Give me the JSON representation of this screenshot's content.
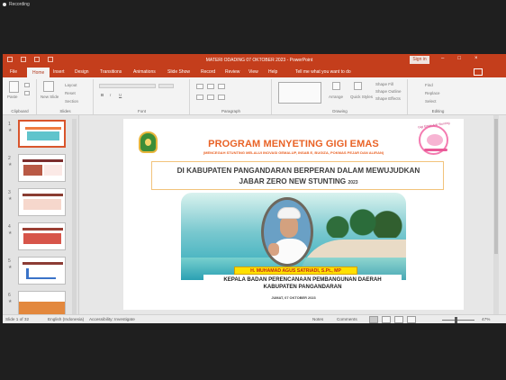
{
  "recording": {
    "label": "Recording"
  },
  "window": {
    "title": "MATERI ODADING 07 OKTOBER 2023  -  PowerPoint",
    "signin": "Sign in",
    "controls": {
      "minimize": "–",
      "maximize": "□",
      "close": "×"
    }
  },
  "tabs": [
    {
      "label": "File"
    },
    {
      "label": "Home"
    },
    {
      "label": "Insert"
    },
    {
      "label": "Design"
    },
    {
      "label": "Transitions"
    },
    {
      "label": "Animations"
    },
    {
      "label": "Slide Show"
    },
    {
      "label": "Record"
    },
    {
      "label": "Review"
    },
    {
      "label": "View"
    },
    {
      "label": "Help"
    }
  ],
  "tell_me": "Tell me what you want to do",
  "ribbon": {
    "clipboard": {
      "paste": "Paste",
      "group": "Clipboard"
    },
    "slides": {
      "new_slide": "New Slide",
      "layout": "Layout",
      "reset": "Reset",
      "section": "Section",
      "group": "Slides"
    },
    "font": {
      "group": "Font"
    },
    "paragraph": {
      "group": "Paragraph"
    },
    "drawing": {
      "arrange": "Arrange",
      "quick_styles": "Quick Styles",
      "shape_fill": "Shape Fill",
      "shape_outline": "Shape Outline",
      "shape_effects": "Shape Effects",
      "group": "Drawing"
    },
    "editing": {
      "find": "Find",
      "replace": "Replace",
      "select": "Select",
      "group": "Editing"
    }
  },
  "thumbnails": [
    {
      "num": "1",
      "star": "★"
    },
    {
      "num": "2",
      "star": "★"
    },
    {
      "num": "3",
      "star": "★"
    },
    {
      "num": "4",
      "star": "★"
    },
    {
      "num": "5",
      "star": "★"
    },
    {
      "num": "6",
      "star": "★"
    }
  ],
  "slide": {
    "program_title": "PROGRAM MENYETING GIGI EMAS",
    "program_sub": "(MENCEGAH STUNTING MELALUI INOVASI GEMALUP, INSAB E, BUGIZA, POKMAS PEJAR DAN ALIRAN)",
    "headline_line1": "DI KABUPATEN PANGANDARAN BERPERAN DALAM MEWUJUDKAN",
    "headline_line2": "JABAR ZERO NEW STUNTING",
    "year": "2023",
    "person_name": "H. MUHAMAD AGUS SATRIADI, S.Pt., MP",
    "office_line1": "KEPALA BADAN PERENCANAAN PEMBANGUNAN DAERAH",
    "office_line2": "KABUPATEN PANGANDARAN",
    "date": "JUMAT, 07 OKTOBER 2023",
    "logo_text": "Gigi Emas Anti Stunting"
  },
  "status": {
    "slide": "Slide 1 of 32",
    "language": "English (Indonesia)",
    "accessibility": "Accessibility: Investigate",
    "notes": "Notes",
    "comments": "Comments",
    "zoom": "47%"
  },
  "colors": {
    "brand": "#c43e1c",
    "title_orange": "#e96225",
    "name_bar": "#ffe000"
  }
}
